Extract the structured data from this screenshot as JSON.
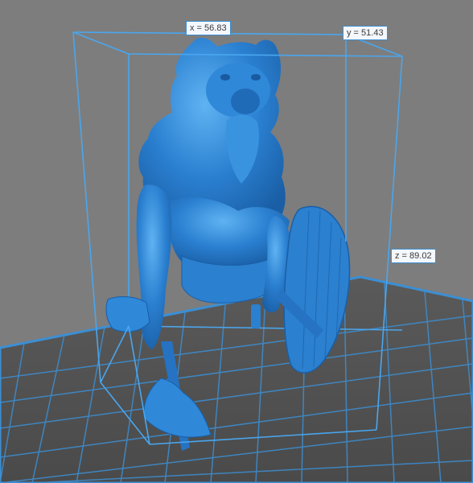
{
  "viewport": {
    "background_color": "#7d7d7d",
    "build_plate_color": "#4a4a4a",
    "grid_color": "#3c8fd4",
    "model_color": "#2a7fd0",
    "bounding_box_color": "#4aa6ee"
  },
  "dimensions": {
    "x_label": "x = 56.83",
    "y_label": "y = 51.43",
    "z_label": "z = 89.02"
  },
  "model": {
    "description_icon": "bear-pelt-barbarian-bust-icon",
    "parts": [
      "bear-head-icon",
      "axe-icon",
      "shield-icon"
    ]
  }
}
